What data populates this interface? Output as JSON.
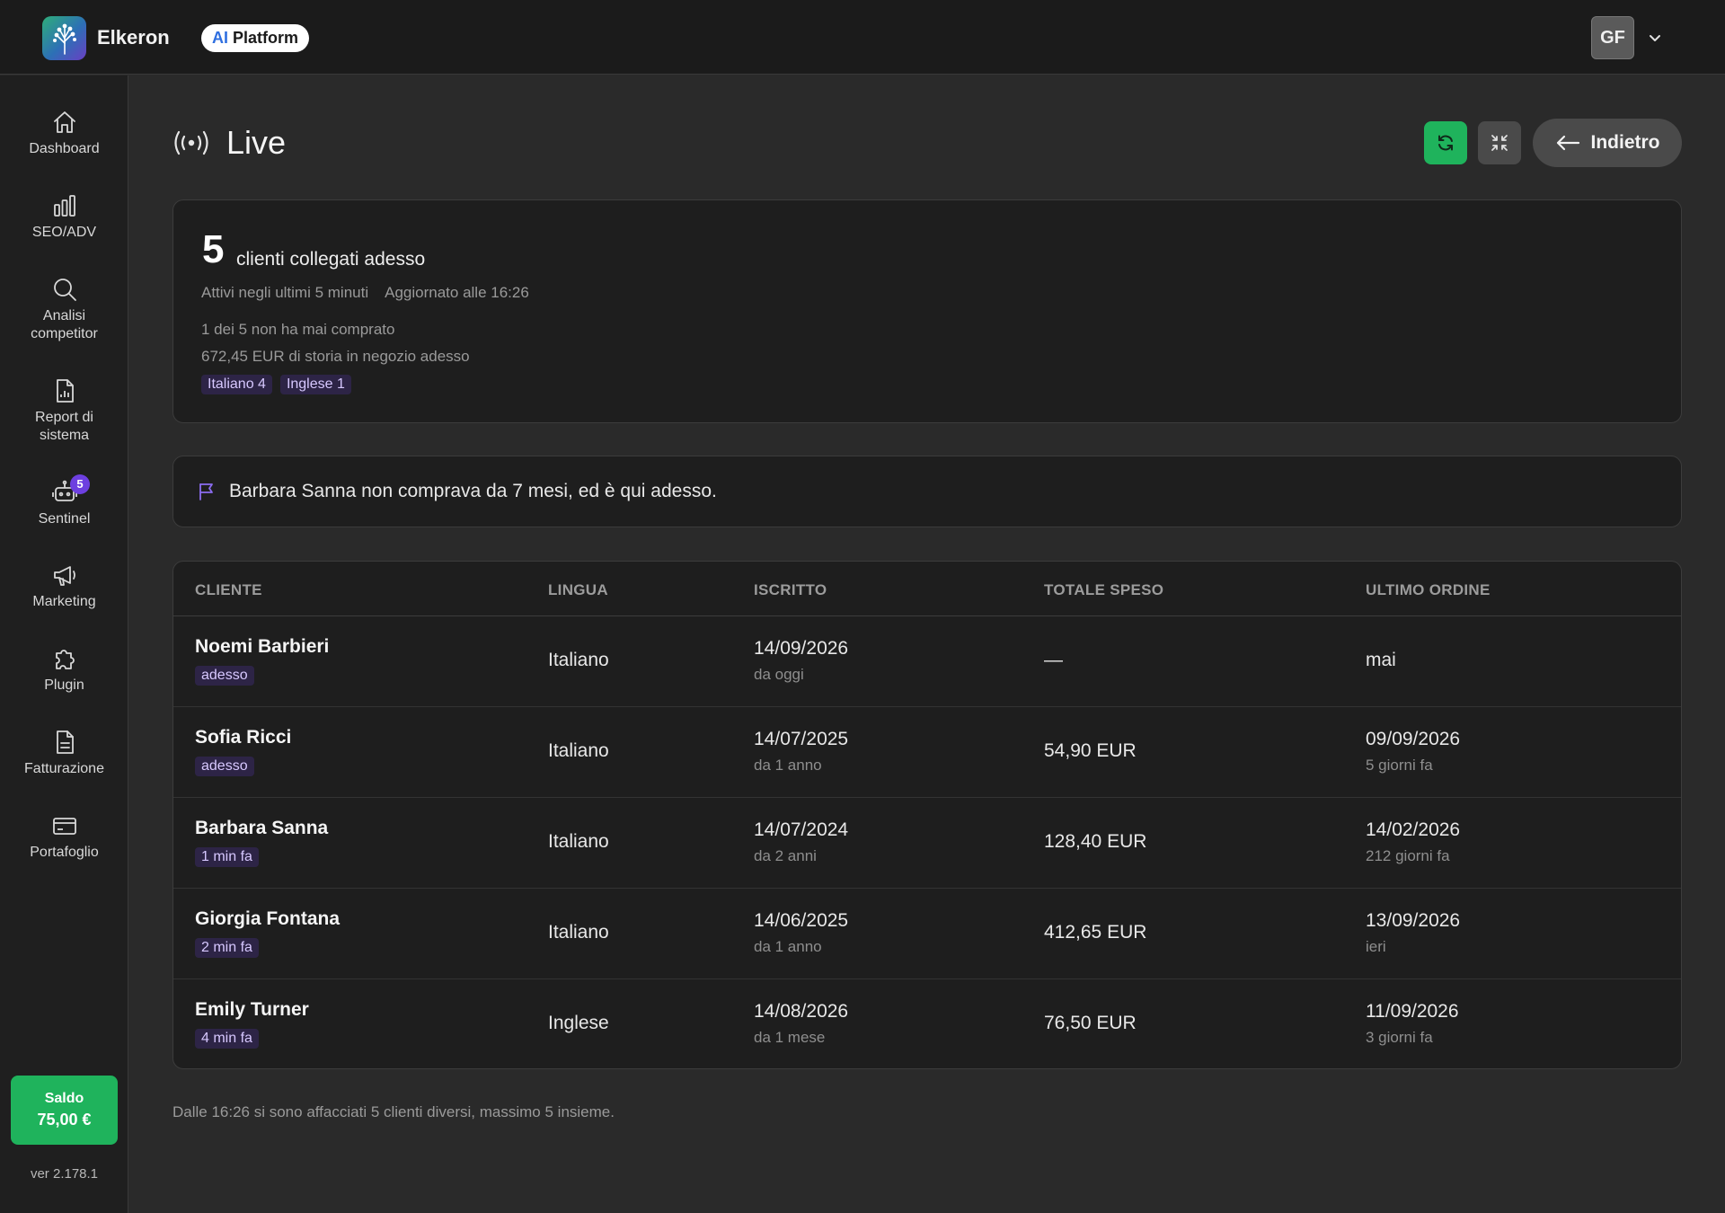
{
  "app": {
    "brand": "Elkeron",
    "platform_ai": "AI",
    "platform_label": "Platform",
    "user_initials": "GF"
  },
  "sidebar": {
    "items": [
      {
        "label": "Dashboard",
        "icon": "home-icon"
      },
      {
        "label": "SEO/ADV",
        "icon": "bar-chart-icon"
      },
      {
        "label": "Analisi competitor",
        "icon": "search-icon"
      },
      {
        "label": "Report di sistema",
        "icon": "report-icon"
      },
      {
        "label": "Sentinel",
        "icon": "robot-icon",
        "badge": "5"
      },
      {
        "label": "Marketing",
        "icon": "megaphone-icon"
      },
      {
        "label": "Plugin",
        "icon": "puzzle-icon"
      },
      {
        "label": "Fatturazione",
        "icon": "document-icon"
      },
      {
        "label": "Portafoglio",
        "icon": "wallet-card-icon"
      }
    ],
    "saldo_label": "Saldo",
    "saldo_value": "75,00 €",
    "version": "ver 2.178.1"
  },
  "header": {
    "title": "Live",
    "back_label": "Indietro"
  },
  "summary": {
    "count": "5",
    "count_label": "clienti collegati adesso",
    "active_window": "Attivi negli ultimi 5 minuti",
    "updated": "Aggiornato alle 16:26",
    "never_bought": "1 dei 5 non ha mai comprato",
    "history": "672,45 EUR di storia in negozio adesso",
    "languages": [
      "Italiano 4",
      "Inglese 1"
    ]
  },
  "alert": {
    "text": "Barbara Sanna non comprava da 7 mesi, ed è qui adesso."
  },
  "table": {
    "headers": [
      "CLIENTE",
      "LINGUA",
      "ISCRITTO",
      "TOTALE SPESO",
      "ULTIMO ORDINE"
    ],
    "rows": [
      {
        "name": "Noemi Barbieri",
        "seen": "adesso",
        "lang": "Italiano",
        "joined": "14/09/2026",
        "joined_rel": "da oggi",
        "spent": "—",
        "last_order": "mai",
        "last_order_rel": ""
      },
      {
        "name": "Sofia Ricci",
        "seen": "adesso",
        "lang": "Italiano",
        "joined": "14/07/2025",
        "joined_rel": "da 1 anno",
        "spent": "54,90 EUR",
        "last_order": "09/09/2026",
        "last_order_rel": "5 giorni fa"
      },
      {
        "name": "Barbara Sanna",
        "seen": "1 min fa",
        "lang": "Italiano",
        "joined": "14/07/2024",
        "joined_rel": "da 2 anni",
        "spent": "128,40 EUR",
        "last_order": "14/02/2026",
        "last_order_rel": "212 giorni fa"
      },
      {
        "name": "Giorgia Fontana",
        "seen": "2 min fa",
        "lang": "Italiano",
        "joined": "14/06/2025",
        "joined_rel": "da 1 anno",
        "spent": "412,65 EUR",
        "last_order": "13/09/2026",
        "last_order_rel": "ieri"
      },
      {
        "name": "Emily Turner",
        "seen": "4 min fa",
        "lang": "Inglese",
        "joined": "14/08/2026",
        "joined_rel": "da 1 mese",
        "spent": "76,50 EUR",
        "last_order": "11/09/2026",
        "last_order_rel": "3 giorni fa"
      }
    ]
  },
  "footer": {
    "note": "Dalle 16:26 si sono affacciati 5 clienti diversi, massimo 5 insieme."
  },
  "colors": {
    "accent_green": "#1fb35c",
    "tag_purple": "#2d2446",
    "badge_purple": "#6d3fe0"
  }
}
